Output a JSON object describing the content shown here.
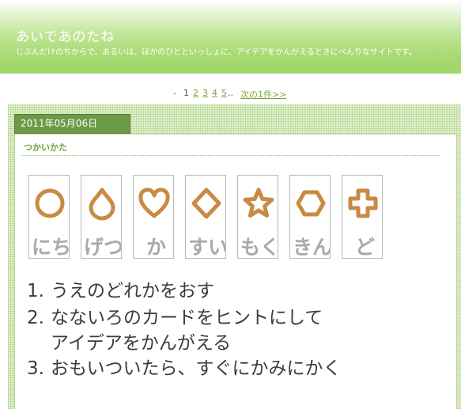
{
  "header": {
    "site_title": "あいであのたね",
    "site_description": "じぶんだけのちからで、あるいは、ほかのひとといっしょに、アイデアをかんがえるときにべんりなサイトです。"
  },
  "pager": {
    "prefix": "-",
    "current": "1",
    "pages": [
      "2",
      "3",
      "4",
      "5"
    ],
    "ellipsis": "..",
    "next": "次の1件>>"
  },
  "post": {
    "date": "2011年05月06日",
    "title": "つかいかた"
  },
  "cards": [
    {
      "icon": "circle-icon",
      "label": "にち"
    },
    {
      "icon": "drop-icon",
      "label": "げつ"
    },
    {
      "icon": "heart-icon",
      "label": "か"
    },
    {
      "icon": "diamond-icon",
      "label": "すい"
    },
    {
      "icon": "star-icon",
      "label": "もく"
    },
    {
      "icon": "hexagon-icon",
      "label": "きん"
    },
    {
      "icon": "cross-icon",
      "label": "ど"
    }
  ],
  "steps": [
    {
      "num": "1.",
      "lines": [
        "うえのどれかをおす"
      ]
    },
    {
      "num": "2.",
      "lines": [
        "なないろのカードをヒントにして",
        "アイデアをかんがえる"
      ]
    },
    {
      "num": "3.",
      "lines": [
        "おもいついたら、すぐにかみにかく"
      ]
    }
  ],
  "colors": {
    "header_green": "#9fd566",
    "accent_green": "#6fa336",
    "date_tab": "#6c9a45",
    "shape_fill": "#c98a43",
    "card_label": "#a9a9a9"
  }
}
